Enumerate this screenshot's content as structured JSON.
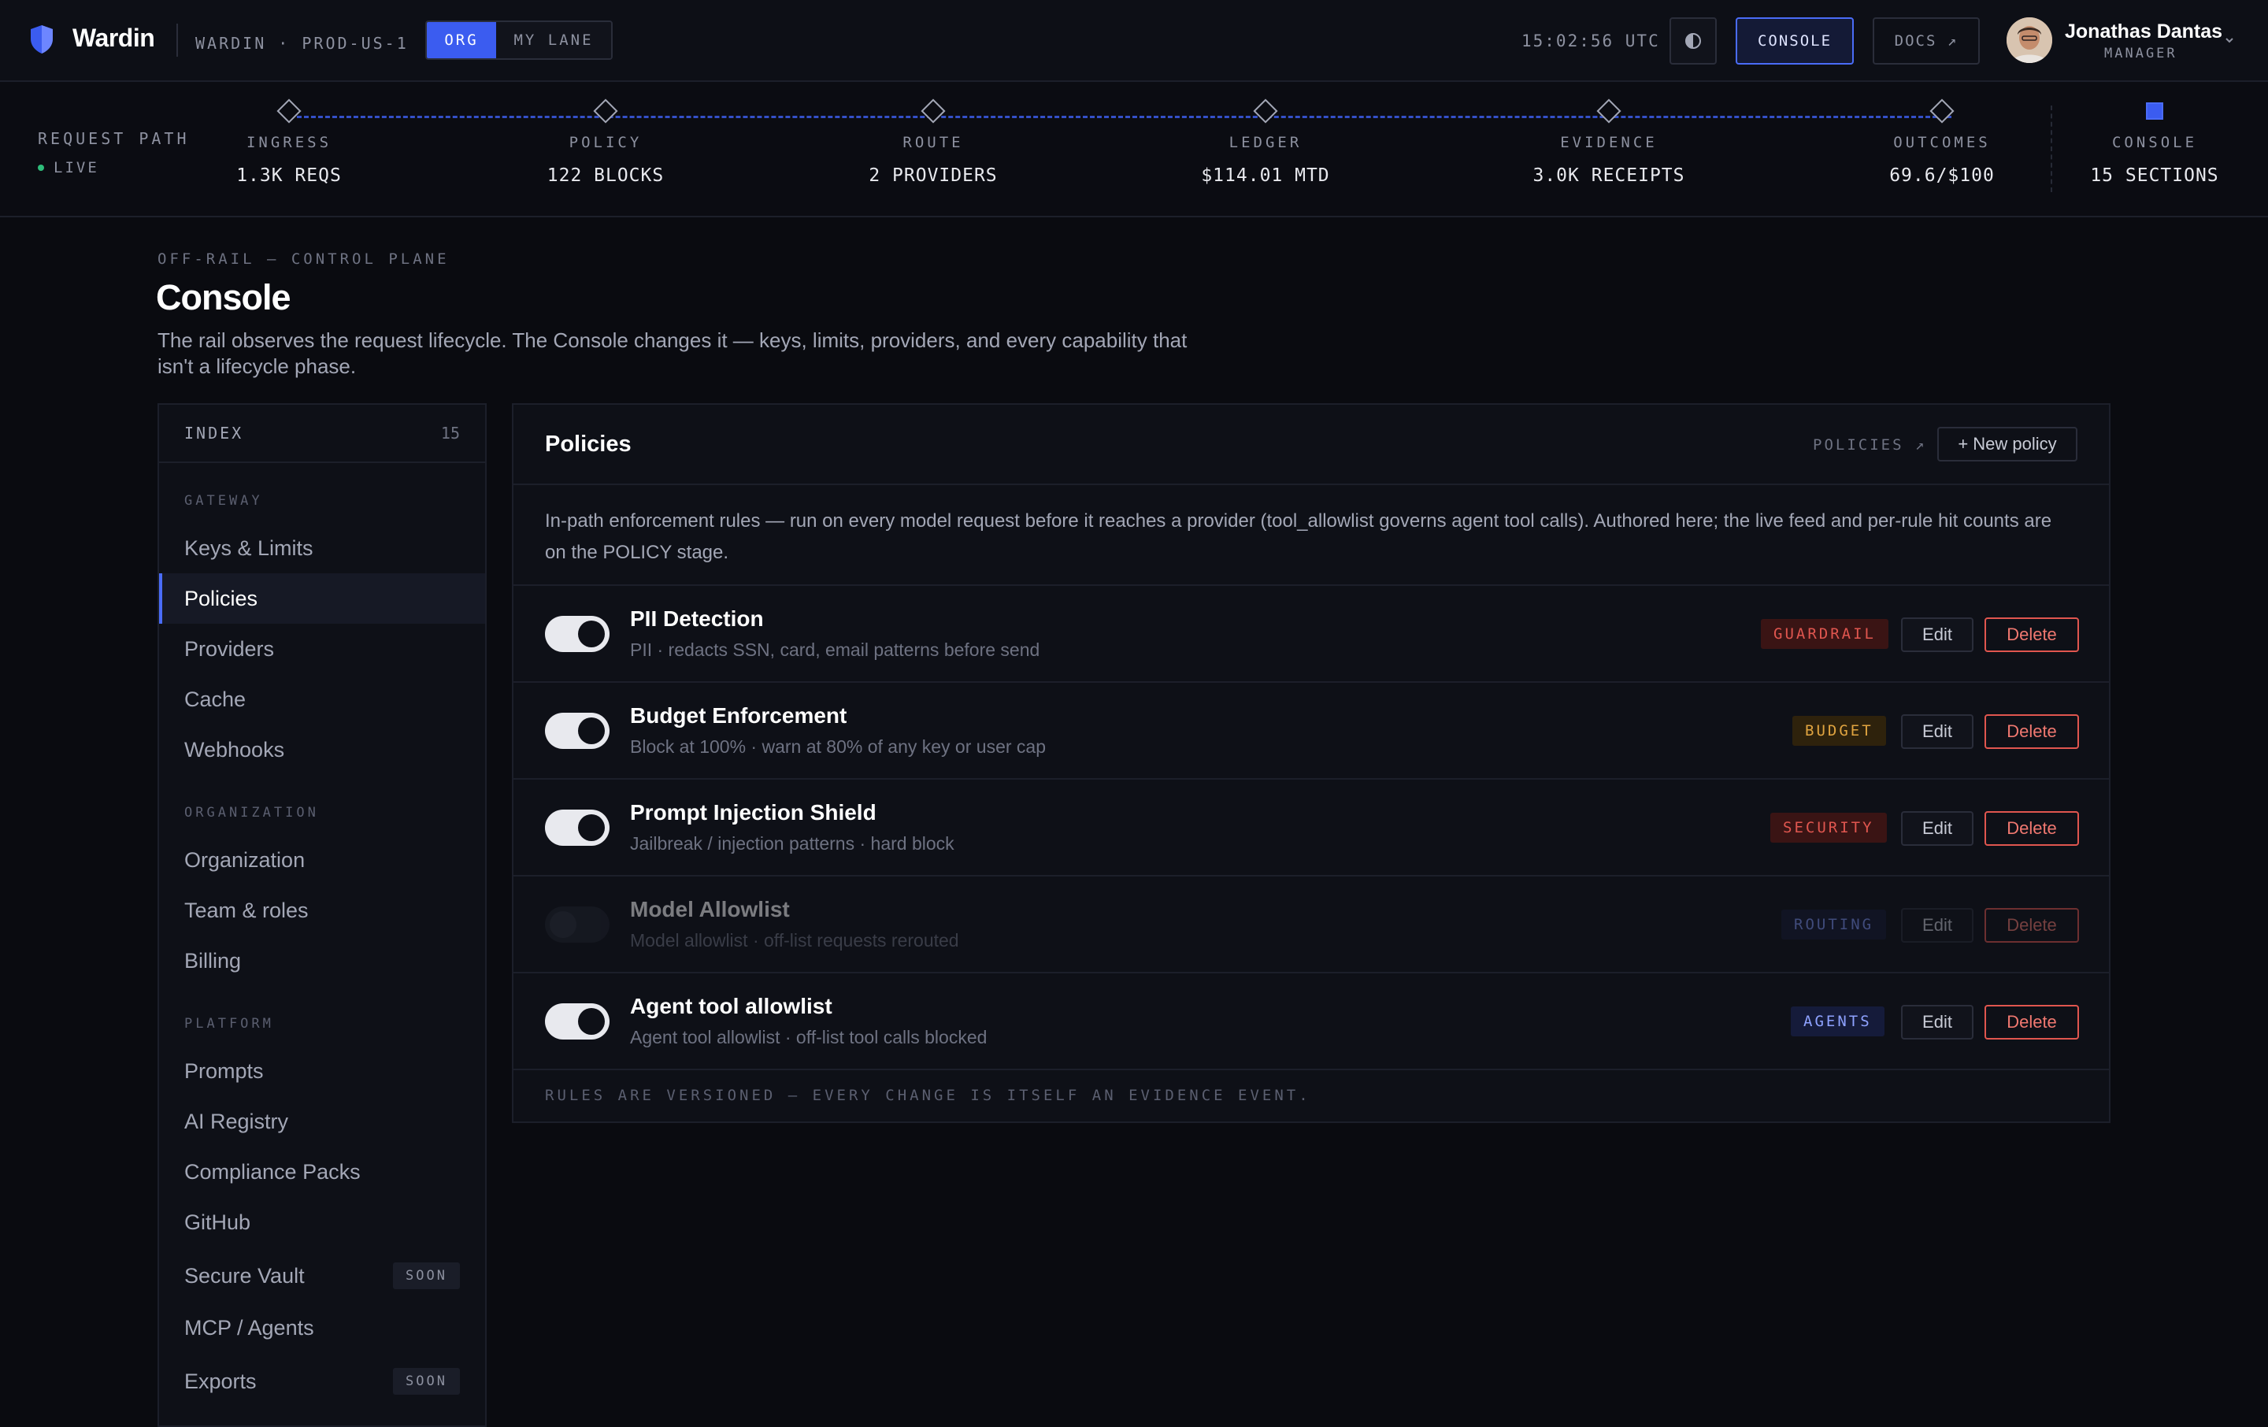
{
  "topbar": {
    "brand": "Wardin",
    "env": "WARDIN · PROD-US-1",
    "scope_options": [
      "ORG",
      "MY LANE"
    ],
    "scope_selected": "ORG",
    "clock": "15:02:56 UTC",
    "console_label": "CONSOLE",
    "docs_label": "DOCS ↗",
    "user": {
      "name": "Jonathas Dantas",
      "role": "MANAGER"
    },
    "accent": "#3b5cf0"
  },
  "request_path": {
    "label": "REQUEST PATH",
    "status": "LIVE",
    "stages": [
      {
        "name": "INGRESS",
        "value": "1.3K REQS"
      },
      {
        "name": "POLICY",
        "value": "122 BLOCKS"
      },
      {
        "name": "ROUTE",
        "value": "2 PROVIDERS"
      },
      {
        "name": "LEDGER",
        "value": "$114.01 MTD"
      },
      {
        "name": "EVIDENCE",
        "value": "3.0K RECEIPTS"
      },
      {
        "name": "OUTCOMES",
        "value": "69.6/$100"
      },
      {
        "name": "CONSOLE",
        "value": "15 SECTIONS"
      }
    ]
  },
  "header": {
    "crumb": "OFF-RAIL — CONTROL PLANE",
    "title": "Console",
    "description": "The rail observes the request lifecycle. The Console changes it — keys, limits, providers, and every capability that isn't a lifecycle phase."
  },
  "sidebar": {
    "title": "INDEX",
    "count": "15",
    "groups": [
      {
        "label": "GATEWAY",
        "items": [
          "Keys & Limits",
          "Policies",
          "Providers",
          "Cache",
          "Webhooks"
        ]
      },
      {
        "label": "ORGANIZATION",
        "items": [
          "Organization",
          "Team & roles",
          "Billing"
        ]
      },
      {
        "label": "PLATFORM",
        "items": [
          "Prompts",
          "AI Registry",
          "Compliance Packs",
          "GitHub",
          "Secure Vault",
          "MCP / Agents",
          "Exports"
        ]
      }
    ],
    "selected": "Policies",
    "soon_label": "SOON"
  },
  "panel": {
    "title": "Policies",
    "link_label": "POLICIES ↗",
    "new_label": "+ New policy",
    "intro": "In-path enforcement rules — run on every model request before it reaches a provider (tool_allowlist governs agent tool calls). Authored here; the live feed and per-rule hit counts are on the POLICY stage.",
    "edit_label": "Edit",
    "delete_label": "Delete",
    "policies": [
      {
        "name": "PII Detection",
        "sub": "PII · redacts SSN, card, email patterns before send",
        "badge": "GUARDRAIL",
        "enabled": true,
        "badge_bg": "#3a1414",
        "badge_fg": "#e0564f"
      },
      {
        "name": "Budget Enforcement",
        "sub": "Block at 100% · warn at 80% of any key or user cap",
        "badge": "BUDGET",
        "enabled": true,
        "badge_bg": "#2e220c",
        "badge_fg": "#e0a440"
      },
      {
        "name": "Prompt Injection Shield",
        "sub": "Jailbreak / injection patterns · hard block",
        "badge": "SECURITY",
        "enabled": true,
        "badge_bg": "#3a1414",
        "badge_fg": "#e0564f"
      },
      {
        "name": "Model Allowlist",
        "sub": "Model allowlist · off-list requests rerouted",
        "badge": "ROUTING",
        "enabled": false,
        "badge_bg": "#151b33",
        "badge_fg": "#7d93f5"
      },
      {
        "name": "Agent tool allowlist",
        "sub": "Agent tool allowlist · off-list tool calls blocked",
        "badge": "AGENTS",
        "enabled": true,
        "badge_bg": "#151b3a",
        "badge_fg": "#8ea2ff"
      }
    ],
    "footer": "RULES ARE VERSIONED — EVERY CHANGE IS ITSELF AN EVIDENCE EVENT."
  }
}
